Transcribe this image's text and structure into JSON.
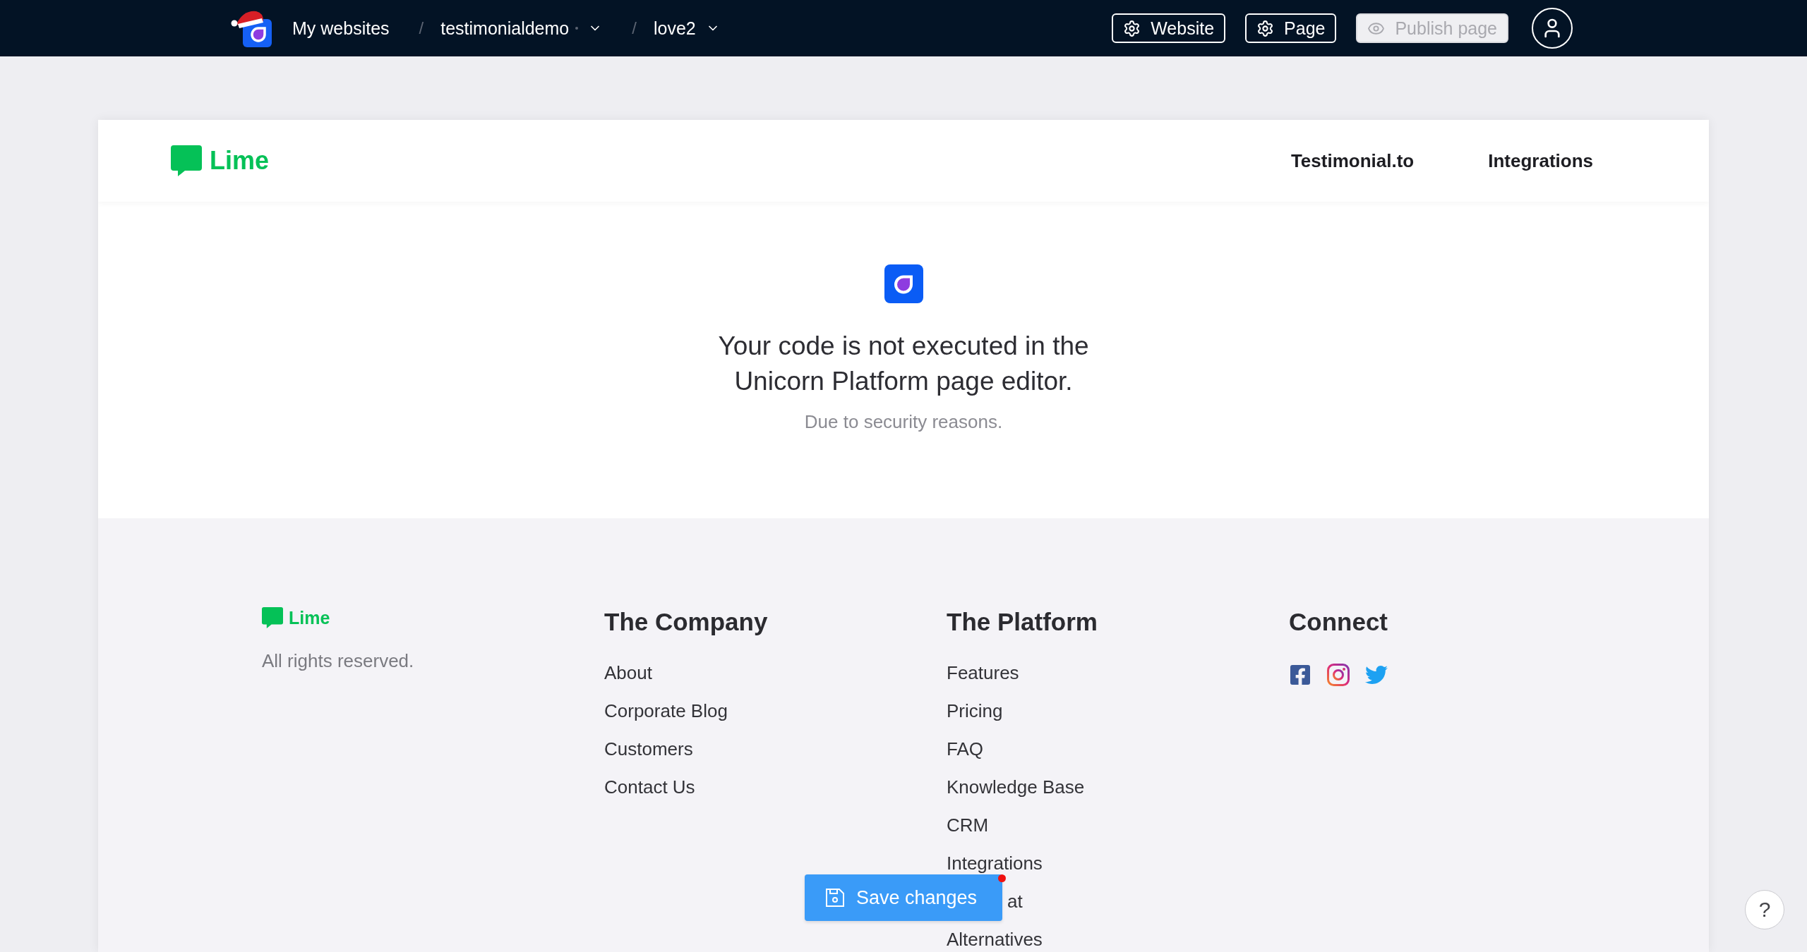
{
  "topbar": {
    "breadcrumbs": [
      {
        "label": "My websites",
        "kind": "link",
        "status_dot": false
      },
      {
        "separator": "/",
        "label": "testimonialdemo",
        "kind": "dropdown",
        "status_dot": true
      },
      {
        "separator": "/",
        "label": "love2",
        "kind": "dropdown",
        "status_dot": false
      }
    ],
    "buttons": [
      {
        "label": "Website",
        "kind": "settings",
        "disabled": false
      },
      {
        "label": "Page",
        "kind": "settings",
        "disabled": false
      },
      {
        "label": "Publish page",
        "kind": "preview",
        "disabled": true
      }
    ]
  },
  "site_header": {
    "brand": "Lime",
    "nav": [
      "Testimonial.to",
      "Integrations"
    ]
  },
  "notice": {
    "message": "Your code is not executed in the Unicorn Platform page editor.",
    "note": "Due to security reasons."
  },
  "footer": {
    "brand": "Lime",
    "copyright": "All rights reserved.",
    "columns": [
      {
        "title": "The Company",
        "links": [
          {
            "label": "About",
            "kind": "full"
          },
          {
            "label": "Corporate Blog",
            "kind": "full"
          },
          {
            "label": "Customers",
            "kind": "full"
          },
          {
            "label": "Contact Us",
            "kind": "full"
          }
        ]
      },
      {
        "title": "The Platform",
        "links": [
          {
            "label": "Features",
            "kind": "full"
          },
          {
            "label": "Pricing",
            "kind": "full"
          },
          {
            "label": "FAQ",
            "kind": "full"
          },
          {
            "label": "Knowledge Base",
            "kind": "full"
          },
          {
            "label": "CRM",
            "kind": "full"
          },
          {
            "label": "Integrations",
            "kind": "full"
          },
          {
            "label": "at",
            "kind": "covered"
          },
          {
            "label": "Alternatives",
            "kind": "full"
          }
        ]
      }
    ],
    "connect": {
      "title": "Connect"
    }
  },
  "save_button": {
    "label": "Save changes",
    "unsaved": true
  },
  "help_button": {
    "label": "?"
  }
}
